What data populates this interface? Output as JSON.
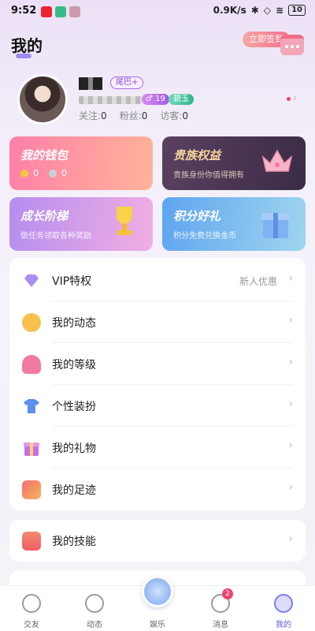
{
  "status": {
    "time": "9:52",
    "speed": "0.9K/s",
    "battery": "10"
  },
  "header": {
    "title": "我的",
    "signin_label": "立即签到"
  },
  "profile": {
    "tag": "尾巴+",
    "badge_a": "19",
    "badge_b": "碧玉",
    "stats": [
      {
        "label": "关注:",
        "value": "0"
      },
      {
        "label": "粉丝:",
        "value": "0"
      },
      {
        "label": "访客:",
        "value": "0"
      }
    ]
  },
  "cards": [
    {
      "title": "我的钱包",
      "subtitle": "",
      "coin1": "0",
      "coin2": "0"
    },
    {
      "title": "贵族权益",
      "subtitle": "贵族身份你值得拥有"
    },
    {
      "title": "成长阶梯",
      "subtitle": "做任务领取各种奖励"
    },
    {
      "title": "积分好礼",
      "subtitle": "积分免费兑换金币"
    }
  ],
  "menu": [
    {
      "label": "VIP特权",
      "right": "新人优惠",
      "icon": "diamond-icon",
      "color": "#a98ff2"
    },
    {
      "label": "我的动态",
      "right": "",
      "icon": "pen-icon",
      "color": "#f7c04f"
    },
    {
      "label": "我的等级",
      "right": "",
      "icon": "medal-icon",
      "color": "#f27aa0"
    },
    {
      "label": "个性装扮",
      "right": "",
      "icon": "shirt-icon",
      "color": "#5b8ff0"
    },
    {
      "label": "我的礼物",
      "right": "",
      "icon": "gift-icon",
      "color": "#c86fe6"
    },
    {
      "label": "我的足迹",
      "right": "",
      "icon": "footprint-icon",
      "color": "#f49b5c"
    }
  ],
  "menu2": {
    "label": "我的技能",
    "icon": "skill-icon",
    "color": "#f2706a"
  },
  "tabs": [
    {
      "label": "交友",
      "active": false
    },
    {
      "label": "动态",
      "active": false
    },
    {
      "label": "娱乐",
      "active": false
    },
    {
      "label": "消息",
      "active": false,
      "badge": "2"
    },
    {
      "label": "我的",
      "active": true
    }
  ],
  "colors": {
    "accent": "#7b7ef0",
    "pink": "#ff7fa8",
    "badge": "#f0446b"
  }
}
